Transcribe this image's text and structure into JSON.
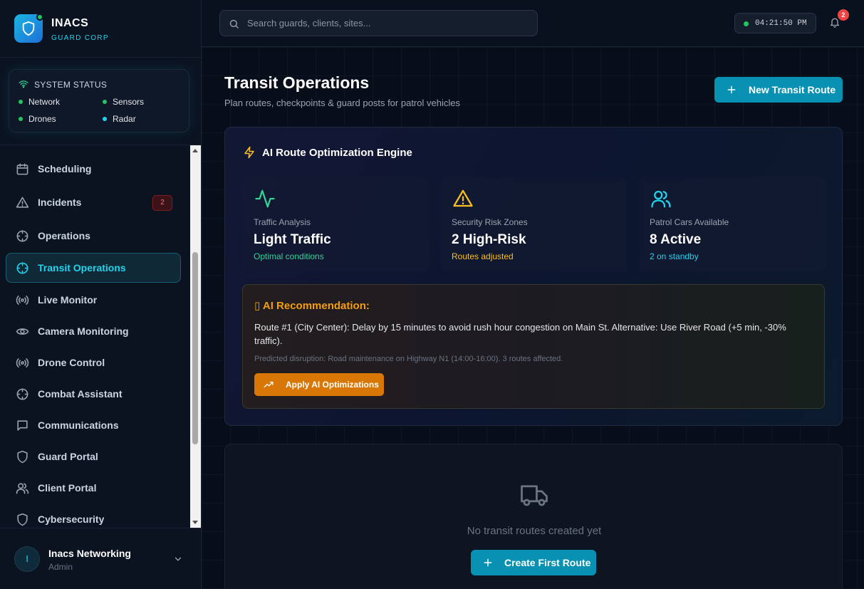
{
  "brand": {
    "name": "INACS",
    "subtitle": "GUARD CORP"
  },
  "system_status": {
    "title": "SYSTEM STATUS",
    "items": [
      {
        "label": "Network",
        "color": "#22c55e"
      },
      {
        "label": "Sensors",
        "color": "#22c55e"
      },
      {
        "label": "Drones",
        "color": "#22c55e"
      },
      {
        "label": "Radar",
        "color": "#22c55e"
      }
    ]
  },
  "nav": {
    "items": [
      {
        "label": "Scheduling",
        "icon": "calendar-icon"
      },
      {
        "label": "Incidents",
        "icon": "warning-icon",
        "badge": "2"
      },
      {
        "label": "Operations",
        "icon": "crosshair-icon"
      },
      {
        "label": "Transit Operations",
        "icon": "crosshair-icon",
        "active": true
      },
      {
        "label": "Live Monitor",
        "icon": "broadcast-icon"
      },
      {
        "label": "Camera Monitoring",
        "icon": "eye-icon"
      },
      {
        "label": "Drone Control",
        "icon": "broadcast-icon"
      },
      {
        "label": "Combat Assistant",
        "icon": "crosshair-icon"
      },
      {
        "label": "Communications",
        "icon": "message-icon"
      },
      {
        "label": "Guard Portal",
        "icon": "shield-icon"
      },
      {
        "label": "Client Portal",
        "icon": "users-icon"
      },
      {
        "label": "Cybersecurity",
        "icon": "shield-icon"
      }
    ]
  },
  "user": {
    "initial": "I",
    "name": "Inacs Networking",
    "role": "Admin"
  },
  "header": {
    "search_placeholder": "Search guards, clients, sites...",
    "time": "04:21:50 PM",
    "notification_count": "2"
  },
  "page": {
    "title": "Transit Operations",
    "subtitle": "Plan routes, checkpoints & guard posts for patrol vehicles",
    "new_route_label": "New Transit Route"
  },
  "ai_engine": {
    "title": "AI Route Optimization Engine",
    "metrics": [
      {
        "label": "Traffic Analysis",
        "value": "Light Traffic",
        "note": "Optimal conditions",
        "note_color": "#34d399",
        "icon": "activity-icon",
        "icon_color": "#34d399"
      },
      {
        "label": "Security Risk Zones",
        "value": "2 High-Risk",
        "note": "Routes adjusted",
        "note_color": "#fbbf24",
        "icon": "warning-icon",
        "icon_color": "#fbbf24"
      },
      {
        "label": "Patrol Cars Available",
        "value": "8 Active",
        "note": "2 on standby",
        "note_color": "#22d3ee",
        "icon": "users-icon",
        "icon_color": "#22d3ee"
      }
    ],
    "recommendation": {
      "title": "▯ AI Recommendation:",
      "text": "Route #1 (City Center): Delay by 15 minutes to avoid rush hour congestion on Main St. Alternative: Use River Road (+5 min, -30% traffic).",
      "note": "Predicted disruption: Road maintenance on Highway N1 (14:00-16:00). 3 routes affected.",
      "button_label": "Apply AI Optimizations"
    }
  },
  "empty_state": {
    "text": "No transit routes created yet",
    "button_label": "Create First Route"
  },
  "colors": {
    "accent": "#22d3ee",
    "primary_button": "#0891b2",
    "warning": "#f59e0b",
    "danger": "#ef4444",
    "success": "#22c55e"
  }
}
